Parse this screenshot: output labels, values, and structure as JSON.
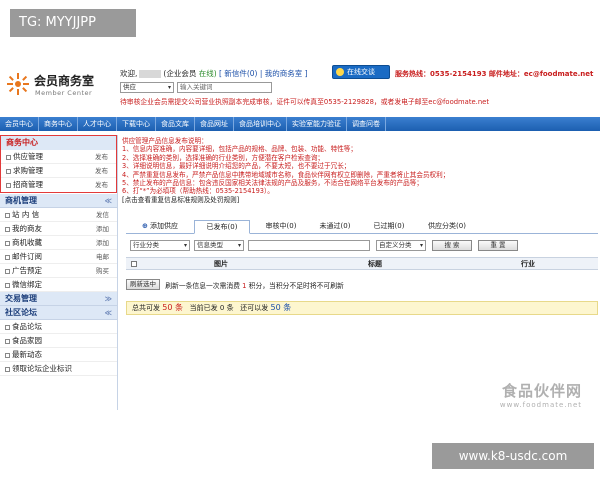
{
  "overlay_tag": "TG: MYYJJPP",
  "bottom_watermark": "www.k8-usdc.com",
  "header": {
    "logo_title": "会员商务室",
    "logo_subtitle": "Member Center",
    "welcome_prefix": "欢迎,",
    "welcome_role": "(企业会员",
    "welcome_online": "在线)",
    "welcome_links": "[ 新信件(0) | 我的商务室 ]",
    "chat_button": "在线交谈",
    "hotline": "服务热线：0535-2154193 邮件地址：ec@foodmate.net",
    "search_select": "供应",
    "search_placeholder": "输入关键词",
    "notice": "待审核企业会员需提交公司营业执照副本完成审核，证件可以传真至0535-2129828，或者发电子邮至ec@foodmate.net"
  },
  "nav": [
    "会员中心",
    "商务中心",
    "人才中心",
    "下载中心",
    "食品文库",
    "食品网址",
    "食品培训中心",
    "实验室能力验证",
    "调查问卷"
  ],
  "sidebar": {
    "biz_title": "商务中心",
    "biz_items": [
      {
        "label": "供应管理",
        "action": "发布"
      },
      {
        "label": "求购管理",
        "action": "发布"
      },
      {
        "label": "招商管理",
        "action": "发布"
      }
    ],
    "mgmt_title": "商机管理",
    "mgmt_items": [
      {
        "label": "站 内 信",
        "action": "发信"
      },
      {
        "label": "我的商友",
        "action": "添加"
      },
      {
        "label": "商机收藏",
        "action": "添加"
      },
      {
        "label": "邮件订阅",
        "action": "电邮"
      },
      {
        "label": "广告预定",
        "action": "购买"
      },
      {
        "label": "微信绑定",
        "action": ""
      }
    ],
    "trade_title": "交易管理",
    "forum_title": "社区论坛",
    "forum_items": [
      {
        "label": "食品论坛"
      },
      {
        "label": "食品家园"
      },
      {
        "label": "最新动态"
      },
      {
        "label": "领取论坛企业标识"
      }
    ]
  },
  "main": {
    "desc_lines": [
      "供应管理产品信息发布说明：",
      "1、信息内容准确，内容要详细，包括产品的规格、品牌、包装、功能、特性等；",
      "2、选择准确的类别，选择准确的行业类别，方便潜在客户检索查询；",
      "3、详细说明信息，最好详细说明介绍您的产品，不要太短，也不要过于冗长；",
      "4、严禁重复信息发布，严禁产品信息中携带地域城市名称，食品伙伴网有权立即删除，严重者将止其会员权利；",
      "5、禁止发布的产品信息：包含违反国家相关法律法规的产品及服务，不适合在网络平台发布的产品等；",
      "6、打“*”为必填项（帮助热线：0535-2154193）。"
    ],
    "desc_footer": "[点击查看重复信息标准规则及处罚规则]",
    "tabs": [
      {
        "label": "添加供应",
        "plus": "⊕"
      },
      {
        "label": "已发布(0)"
      },
      {
        "label": "审核中(0)"
      },
      {
        "label": "未通过(0)"
      },
      {
        "label": "已过期(0)"
      },
      {
        "label": "供应分类(0)"
      }
    ],
    "filter": {
      "industry": "行业分类",
      "info_type": "信息类型",
      "custom": "自定义分类",
      "search_btn": "搜 索",
      "reset_btn": "重 置"
    },
    "table_headers": {
      "image": "图片",
      "title": "标题",
      "industry": "行业"
    },
    "refresh": {
      "button": "刷新选中",
      "text_pre": "刷新一条信息一次需消费",
      "cost": "1",
      "text_post": "积分，当积分不足时将不可刷新"
    },
    "quota": {
      "can_post_label": "总共可发",
      "can_post": "50 条",
      "posted_label": "当前已发",
      "posted": "0 条",
      "remain_label": "还可以发",
      "remain": "50 条"
    }
  },
  "watermark": {
    "line1": "食品伙伴网",
    "line2": "www.foodmate.net"
  },
  "colors": {
    "nav_blue": "#1c5fb0",
    "alert_red": "#c81d1d",
    "highlight_border": "#e23a3a"
  }
}
